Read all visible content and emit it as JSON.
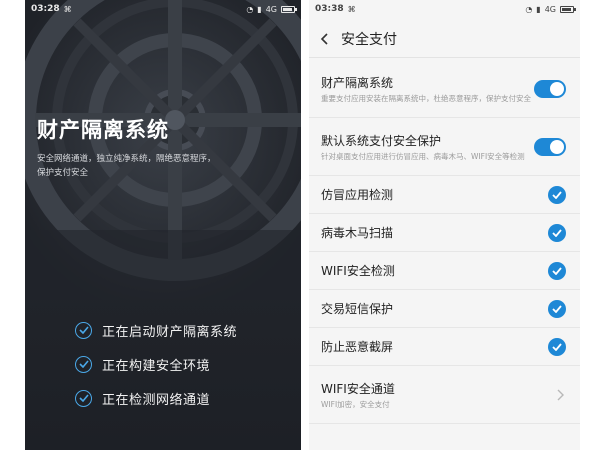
{
  "left_screen": {
    "status_bar": {
      "time": "03:28",
      "network": "4G"
    },
    "title": "财产隔离系统",
    "description": "安全网络通道，独立纯净系统，隔绝恶意程序，保护支付安全",
    "progress_items": [
      {
        "label": "正在启动财产隔离系统"
      },
      {
        "label": "正在构建安全环境"
      },
      {
        "label": "正在检测网络通道"
      }
    ]
  },
  "right_screen": {
    "status_bar": {
      "time": "03:38",
      "network": "4G"
    },
    "title": "安全支付",
    "settings": {
      "isolation": {
        "title": "财产隔离系统",
        "desc": "重要支付应用安装在隔离系统中，杜绝恶意程序，保护支付安全",
        "enabled": true
      },
      "default_protect": {
        "title": "默认系统支付安全保护",
        "desc": "针对桌面支付应用进行仿冒应用、病毒木马、WIFI安全等检测",
        "enabled": true
      },
      "checks": [
        {
          "label": "仿冒应用检测",
          "checked": true
        },
        {
          "label": "病毒木马扫描",
          "checked": true
        },
        {
          "label": "WIFI安全检测",
          "checked": true
        },
        {
          "label": "交易短信保护",
          "checked": true
        },
        {
          "label": "防止恶意截屏",
          "checked": true
        }
      ],
      "wifi_channel": {
        "title": "WIFI安全通道",
        "desc": "WIFI加密，安全支付"
      }
    }
  },
  "colors": {
    "accent": "#1e88d6",
    "dark_bg": "#23262c",
    "light_bg": "#f5f5f5"
  }
}
